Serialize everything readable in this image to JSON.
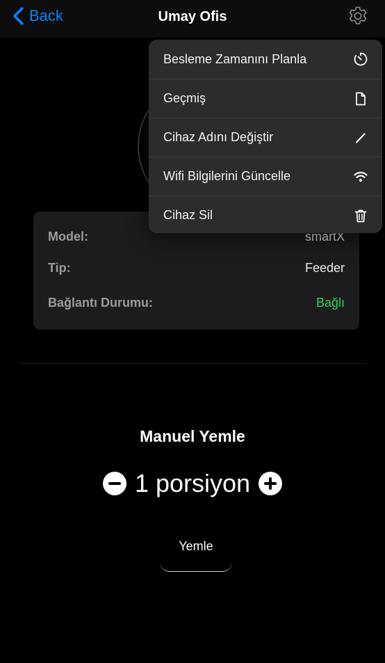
{
  "nav": {
    "back_label": "Back",
    "title": "Umay Ofis",
    "settings_icon": "gear-icon"
  },
  "menu": {
    "items": [
      {
        "label": "Besleme Zamanını Planla",
        "icon": "timer-icon"
      },
      {
        "label": "Geçmiş",
        "icon": "document-icon"
      },
      {
        "label": "Cihaz Adını Değiştir",
        "icon": "pencil-icon"
      },
      {
        "label": "Wifi Bilgilerini Güncelle",
        "icon": "wifi-icon"
      },
      {
        "label": "Cihaz Sil",
        "icon": "trash-icon"
      }
    ]
  },
  "info": {
    "model_label": "Model:",
    "model_value": "smartX",
    "type_label": "Tip:",
    "type_value": "Feeder",
    "status_label": "Bağlantı Durumu:",
    "status_value": "Bağlı"
  },
  "manual": {
    "title": "Manuel Yemle",
    "portion_text": "1 porsiyon",
    "feed_button": "Yemle"
  },
  "colors": {
    "accent": "#0a84ff",
    "connected": "#30d158",
    "background": "#000000",
    "card": "#1c1c1e",
    "menu": "#2c2c2e"
  }
}
